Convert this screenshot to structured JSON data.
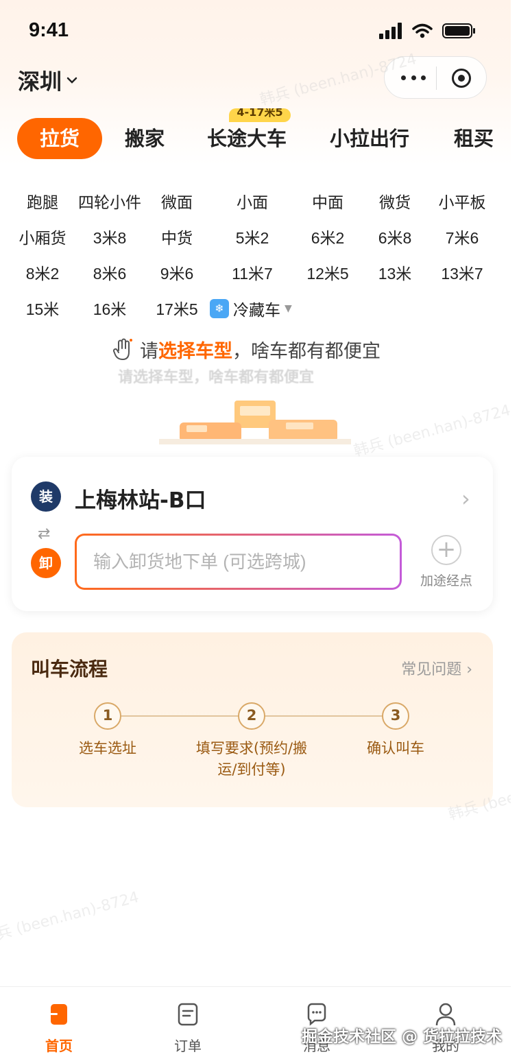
{
  "status": {
    "time": "9:41"
  },
  "nav": {
    "city": "深圳"
  },
  "tabs": [
    {
      "label": "拉货"
    },
    {
      "label": "搬家"
    },
    {
      "label": "长途大车",
      "badge": "4-17米5"
    },
    {
      "label": "小拉出行"
    },
    {
      "label": "租买"
    }
  ],
  "vehicles": {
    "row1": [
      "跑腿",
      "四轮小件",
      "微面",
      "小面",
      "中面",
      "微货",
      "小平板"
    ],
    "row2": [
      "小厢货",
      "3米8",
      "中货",
      "5米2",
      "6米2",
      "6米8",
      "7米6"
    ],
    "row3": [
      "8米2",
      "8米6",
      "9米6",
      "11米7",
      "12米5",
      "13米",
      "13米7"
    ],
    "row4": [
      "15米",
      "16米",
      "17米5"
    ],
    "cold": "冷藏车"
  },
  "hint": {
    "prefix": "请",
    "highlight": "选择车型",
    "suffix": "，啥车都有都便宜",
    "ghost": "请选择车型，啥车都有都便宜"
  },
  "address": {
    "load_tag": "装",
    "unload_tag": "卸",
    "from": "上梅林站-B口",
    "to_placeholder": "输入卸货地下单 (可选跨城)",
    "add_stop": "加途经点"
  },
  "flow": {
    "title": "叫车流程",
    "faq": "常见问题 ›",
    "steps": [
      {
        "num": "1",
        "text": "选车选址"
      },
      {
        "num": "2",
        "text": "填写要求(预约/搬运/到付等)"
      },
      {
        "num": "3",
        "text": "确认叫车"
      }
    ]
  },
  "tabbar": [
    {
      "label": "首页"
    },
    {
      "label": "订单"
    },
    {
      "label": "消息"
    },
    {
      "label": "我的"
    }
  ],
  "watermark": "韩兵 (been.han)-8724",
  "credit": "掘金技术社区 @ 货拉拉技术",
  "colors": {
    "accent": "#ff6600",
    "load": "#1f3a68",
    "flow_text": "#9a5a12"
  }
}
